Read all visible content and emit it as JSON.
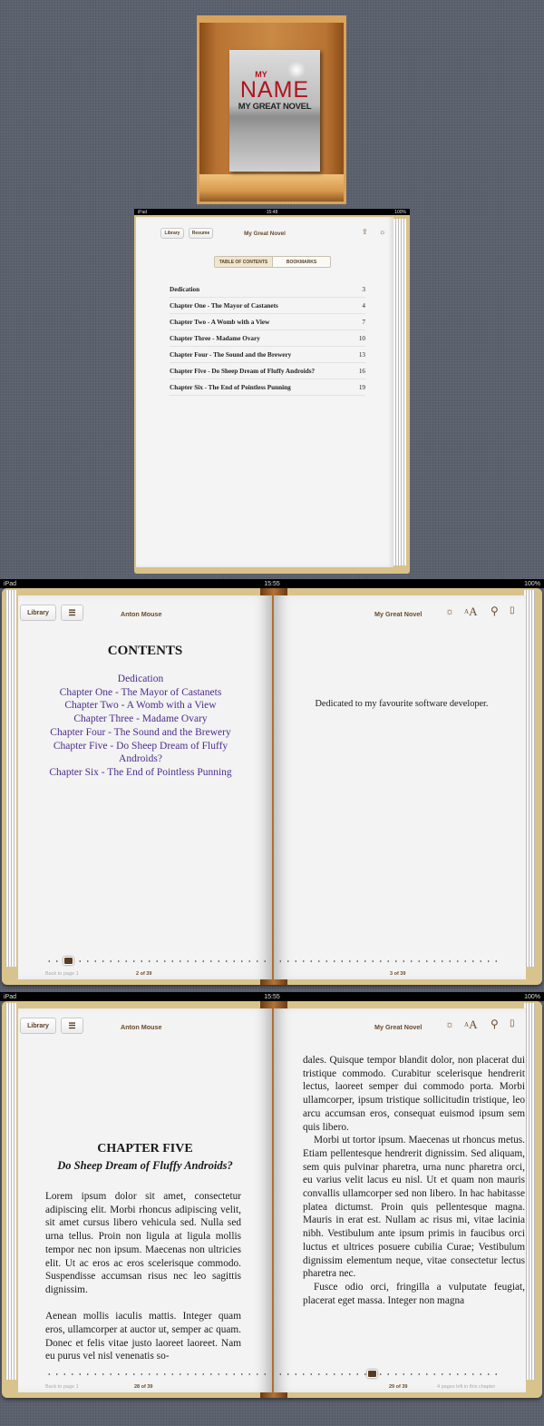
{
  "shelf": {
    "cover": {
      "line1": "MY",
      "line2": "NAME",
      "line3": "MY GREAT NOVEL"
    }
  },
  "mini": {
    "status": {
      "device": "iPad",
      "time": "15:48",
      "battery": "100%"
    },
    "library_label": "Library",
    "resume_label": "Resume",
    "title": "My Great Novel",
    "tabs": [
      {
        "label": "TABLE OF CONTENTS",
        "selected": true
      },
      {
        "label": "BOOKMARKS",
        "selected": false
      }
    ],
    "toc": [
      {
        "title": "Dedication",
        "page": "3"
      },
      {
        "title": "Chapter One - The Mayor of Castanets",
        "page": "4"
      },
      {
        "title": "Chapter Two - A Womb with a View",
        "page": "7"
      },
      {
        "title": "Chapter Three - Madame Ovary",
        "page": "10"
      },
      {
        "title": "Chapter Four - The Sound and the Brewery",
        "page": "13"
      },
      {
        "title": "Chapter Five - Do Sheep Dream of Fluffy Androids?",
        "page": "16"
      },
      {
        "title": "Chapter Six - The End of Pointless Punning",
        "page": "19"
      }
    ]
  },
  "spread1": {
    "status": {
      "device": "iPad",
      "time": "15:55",
      "battery": "100%"
    },
    "library_label": "Library",
    "author": "Anton Mouse",
    "title": "My Great Novel",
    "contents_heading": "CONTENTS",
    "contents": [
      "Dedication",
      "Chapter One - The Mayor of Castanets",
      "Chapter Two - A Womb with a View",
      "Chapter Three - Madame Ovary",
      "Chapter Four - The Sound and the Brewery",
      "Chapter Five - Do Sheep Dream of Fluffy Androids?",
      "Chapter Six - The End of Pointless Punning"
    ],
    "dedication": "Dedicated to my favourite software developer.",
    "back_link": "Back to page 1",
    "left_page": "2 of 39",
    "right_page": "3 of 39",
    "progress": 0.05
  },
  "spread2": {
    "status": {
      "device": "iPad",
      "time": "15:55",
      "battery": "100%"
    },
    "library_label": "Library",
    "author": "Anton Mouse",
    "title": "My Great Novel",
    "chapter": "CHAPTER FIVE",
    "subtitle": "Do Sheep Dream of Fluffy Androids?",
    "left_paras": [
      "Lorem ipsum dolor sit amet, consectetur adipiscing elit. Morbi rhoncus adipiscing velit, sit amet cursus libero vehicula sed. Nulla sed urna tellus. Proin non ligula at ligula mollis tempor nec non ipsum. Maecenas non ultricies elit. Ut ac eros ac eros scelerisque commodo. Suspendisse accumsan risus nec leo sagittis dignissim.",
      "Aenean mollis iaculis mattis. Integer quam eros, ullamcorper at auctor ut, semper ac quam. Donec et felis vitae justo laoreet laoreet. Nam eu purus vel nisl venenatis so-"
    ],
    "right_paras": [
      "dales. Quisque tempor blandit dolor, non placerat dui tristique commodo. Curabitur scelerisque hendrerit lectus, laoreet semper dui commodo porta. Morbi ullamcorper, ipsum tristique sollicitudin tristique, leo arcu accumsan eros, consequat euismod ipsum sem quis libero.",
      "Morbi ut tortor ipsum. Maecenas ut rhoncus metus. Etiam pellentesque hendrerit dignissim. Sed aliquam, sem quis pulvinar pharetra, urna nunc pharetra orci, eu varius velit lacus eu nisl. Ut et quam non mauris convallis ullamcorper sed non libero. In hac habitasse platea dictumst. Proin quis pellentesque magna. Mauris in erat est. Nullam ac risus mi, vitae lacinia nibh. Vestibulum ante ipsum primis in faucibus orci luctus et ultrices posuere cubilia Curae; Vestibulum dignissim elementum neque, vitae consectetur lectus pharetra nec.",
      "Fusce odio orci, fringilla a vulputate feugiat, placerat eget massa. Integer non magna"
    ],
    "back_link": "Back to page 1",
    "left_page": "28 of 39",
    "right_page": "29 of 39",
    "pages_left": "4 pages left in this chapter",
    "progress": 0.72
  }
}
